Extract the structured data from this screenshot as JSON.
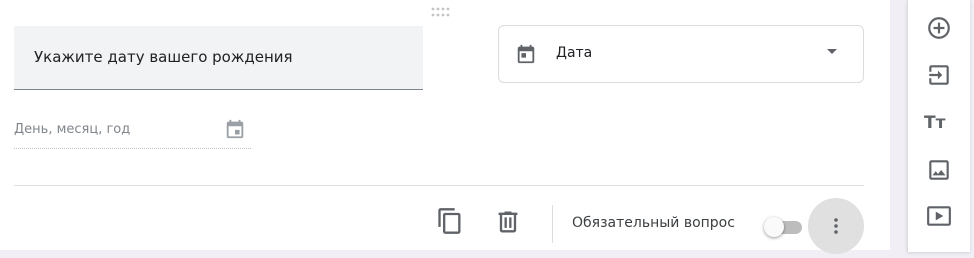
{
  "question": {
    "title": "Укажите дату вашего рождения",
    "type_label": "Дата",
    "date_placeholder": "День, месяц, год"
  },
  "footer": {
    "required_label": "Обязательный вопрос",
    "required_enabled": false
  },
  "sidebar": {
    "text_icon": "Тт",
    "items": [
      "add-question-icon",
      "import-questions-icon",
      "add-title-icon",
      "add-image-icon",
      "add-video-icon"
    ]
  }
}
